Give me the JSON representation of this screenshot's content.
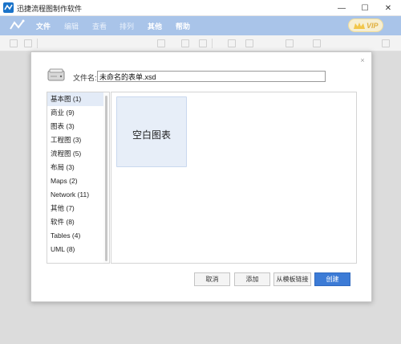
{
  "window": {
    "title": "迅捷流程图制作软件",
    "minimize_glyph": "—",
    "maximize_glyph": "☐",
    "close_glyph": "✕"
  },
  "menubar": {
    "items": [
      {
        "label": "文件",
        "active": true
      },
      {
        "label": "编辑",
        "active": false
      },
      {
        "label": "查看",
        "active": false
      },
      {
        "label": "排列",
        "active": false
      },
      {
        "label": "其他",
        "active": true
      },
      {
        "label": "帮助",
        "active": true
      }
    ],
    "vip_label": "VIP"
  },
  "dialog": {
    "close_glyph": "×",
    "filename_label": "文件名:",
    "filename_value": "未命名的表单.xsd",
    "categories": [
      {
        "label": "基本图 (1)",
        "selected": true
      },
      {
        "label": "商业 (9)",
        "selected": false
      },
      {
        "label": "图表 (3)",
        "selected": false
      },
      {
        "label": "工程图 (3)",
        "selected": false
      },
      {
        "label": "流程图 (5)",
        "selected": false
      },
      {
        "label": "布局 (3)",
        "selected": false
      },
      {
        "label": "Maps (2)",
        "selected": false
      },
      {
        "label": "Network (11)",
        "selected": false
      },
      {
        "label": "其他 (7)",
        "selected": false
      },
      {
        "label": "软件 (8)",
        "selected": false
      },
      {
        "label": "Tables (4)",
        "selected": false
      },
      {
        "label": "UML (8)",
        "selected": false
      }
    ],
    "templates": [
      {
        "label": "空白图表"
      }
    ],
    "buttons": {
      "cancel": "取消",
      "add": "添加",
      "from_template_link": "从模板链接",
      "create": "创建"
    }
  },
  "colors": {
    "menubar": "#a9c4e9",
    "accent": "#3c7bd6",
    "selected_row": "#e3ebf7",
    "template_card": "#e7eef8"
  },
  "icons": [
    "app-logo-icon",
    "flowchart-logo-icon",
    "crown-icon",
    "hard-drive-icon",
    "close-icon"
  ]
}
